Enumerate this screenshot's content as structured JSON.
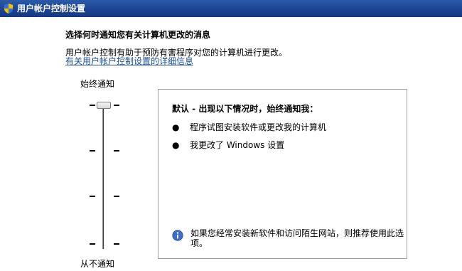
{
  "window": {
    "title": "用户帐户控制设置",
    "title_bar_color": "#1c4493"
  },
  "intro": {
    "heading": "选择何时通知您有关计算机更改的消息",
    "description": "用户帐户控制有助于预防有害程序对您的计算机进行更改。",
    "link": "有关用户帐户控制设置的详细信息"
  },
  "slider": {
    "top_label": "始终通知",
    "bottom_label": "从不通知",
    "levels": 4,
    "selected_level": 4
  },
  "panel": {
    "title": "默认 - 出现以下情况时，始终通知我：",
    "bullet_glyph": "●",
    "bullets": [
      "程序试图安装软件或更改我的计算机",
      "我更改了 Windows 设置"
    ],
    "info_icon": "info-icon",
    "info_text": "如果您经常安装新软件和访问陌生网站，则推荐使用此选项。"
  }
}
